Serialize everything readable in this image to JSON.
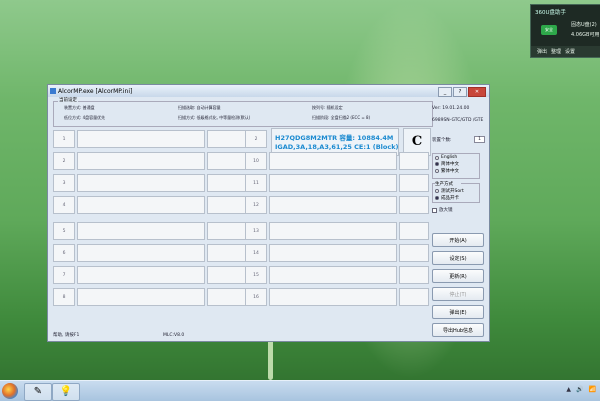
{
  "popup": {
    "title": "360U盘助手",
    "badge": "安全",
    "line1": "固态U盘(2)",
    "line2": "4.06GB可用",
    "actions": [
      "弹出",
      "整理",
      "设置"
    ]
  },
  "window": {
    "title": "AlcorMP.exe [AlcorMP.ini]"
  },
  "settings": {
    "legend": "当前设定",
    "r1": [
      "装置方式: 普通盘",
      "扫描选取: 自动计算容量",
      "按列号: 随机设定"
    ],
    "r2": [
      "低位方式: 4盘容量优先",
      "扫描方式: 低级格式化, 中等量检测(默认)",
      "扫描阶段: 全盘扫描2 (ECC = 8)"
    ]
  },
  "slots": {
    "top": [
      "1",
      "2",
      "3",
      "4"
    ],
    "topR": [
      "9",
      "10",
      "11",
      "12"
    ],
    "bot": [
      "5",
      "6",
      "7",
      "8"
    ],
    "botR": [
      "13",
      "14",
      "15",
      "16"
    ]
  },
  "slot_right_first": "2",
  "device_info": {
    "line1": "H27QDG8M2MTR 容量: 10884.4M",
    "line2": "IGAD,3A,18,A3,61,25 CE:1 (Block)",
    "indicator": "C"
  },
  "side": {
    "version": "Ver: 19.01.24.00",
    "fw": "6989SN-GTC/GTD /GTE",
    "count_label": "装置个数:",
    "count": "1",
    "lang": [
      "English",
      "简体中文",
      "繁体中文"
    ],
    "mode_legend": "生产方式",
    "modes": [
      "测试开Sort",
      "成品开卡"
    ],
    "amplify": "放大镜"
  },
  "buttons": {
    "start": "开始(A)",
    "setting": "设定(S)",
    "refresh": "更新(R)",
    "stop": "停止(T)",
    "eject": "弹出(E)",
    "export": "导出Hub信息"
  },
  "status": {
    "help": "帮助, 请按F1",
    "mlc": "MLC:V8.0"
  },
  "taskbar": {
    "items": [
      "✎",
      "💡"
    ]
  },
  "tray": [
    "▲",
    "🔊",
    "📶"
  ]
}
